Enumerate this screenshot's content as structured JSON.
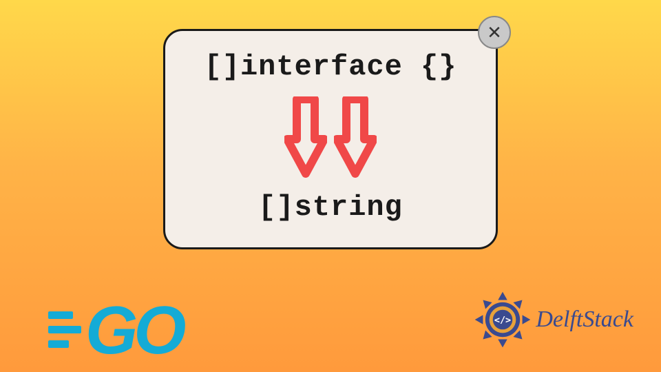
{
  "card": {
    "top_code": "[]interface {}",
    "bottom_code": "[]string",
    "arrow_color": "#f04848"
  },
  "close_button_label": "✕",
  "go_logo_text": "GO",
  "delft_logo_text": "DelftStack",
  "colors": {
    "accent_blue": "#14abd6",
    "delft_blue": "#3a4a8f",
    "arrow_red": "#f04848",
    "card_bg": "#f4eee8"
  }
}
